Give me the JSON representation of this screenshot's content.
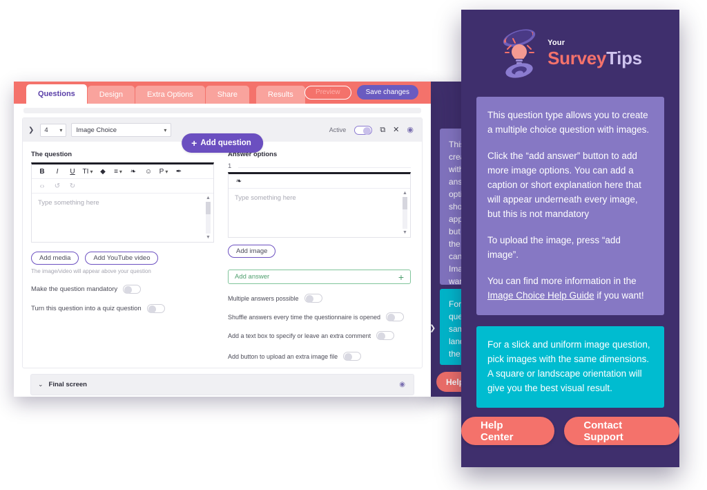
{
  "editor": {
    "tabs": [
      {
        "label": "Questions",
        "active": true
      },
      {
        "label": "Design",
        "active": false
      },
      {
        "label": "Extra Options",
        "active": false
      },
      {
        "label": "Share",
        "active": false
      },
      {
        "label": "Results",
        "active": false
      }
    ],
    "preview_label": "Preview",
    "save_label": "Save changes",
    "add_question_label": "Add question",
    "add_question_plus": "+",
    "question": {
      "number": "4",
      "type": "Image Choice",
      "active_label": "Active",
      "active_on": true,
      "icons": {
        "expand": "❯",
        "duplicate": "⧉",
        "delete": "✕",
        "preview_eye": "◉"
      }
    },
    "left_column": {
      "section_label": "The question",
      "toolbar_row1": [
        "B",
        "I",
        "U",
        "TI",
        "◆",
        "≡",
        "❧",
        "☺",
        "P",
        "✒"
      ],
      "toolbar_row2": [
        "‹›",
        "↺",
        "↻"
      ],
      "placeholder": "Type something here",
      "buttons": [
        {
          "label": "Add media"
        },
        {
          "label": "Add YouTube video"
        }
      ],
      "hint": "The image/video will appear above your question",
      "toggles": [
        {
          "label": "Make the question mandatory",
          "on": false
        },
        {
          "label": "Turn this question into a quiz question",
          "on": false
        }
      ]
    },
    "right_column": {
      "section_label": "Answer options",
      "answer_index": "1",
      "link_icon": "❧",
      "placeholder": "Type something here",
      "add_image_label": "Add image",
      "add_answer_label": "Add answer",
      "add_answer_plus": "+",
      "toggles": [
        {
          "label": "Multiple answers possible",
          "on": false
        },
        {
          "label": "Shuffle answers every time the questionnaire is opened",
          "on": false
        },
        {
          "label": "Add a text box to specify or leave an extra comment",
          "on": false
        },
        {
          "label": "Add button to upload an extra image file",
          "on": false
        }
      ]
    },
    "final_screen": {
      "label": "Final screen",
      "chevron": "⌄",
      "eye": "◉"
    }
  },
  "help_panel": {
    "logo": {
      "your": "Your",
      "survey": "Survey",
      "tips": "Tips",
      "icon_name": "lightbulb-logo-icon"
    },
    "purple_card": {
      "paragraphs": [
        "This question type allows you to create a multiple choice question with images.",
        "Click the “add answer” button to add more image options. You can add a caption or short explanation here that will appear underneath every image, but this is not mandatory",
        "To upload the image, press “add image”."
      ],
      "link_intro": "You can find more information in the",
      "link_text": "Image Choice Help Guide",
      "link_outro": "if you want!"
    },
    "teal_card": {
      "text": "For a slick and uniform image question, pick images with the same dimensions. A square or landscape orientation will give you the best visual result."
    },
    "actions": [
      {
        "label": "Help Center"
      },
      {
        "label": "Contact Support"
      }
    ]
  },
  "background_panel": {
    "arrow": "❯",
    "help_label": "Help",
    "purple_card_text": "This question type allows you to create a multiple choice question with images.\n\nClick the “add answer” button to add more image options. You can add a caption or short explanation here that will appear underneath every image, but this is not mandatory\n\nTo upload the image, press “add image”.\n\nYou can find more information in the Image Choice Help Guide if you want!",
    "teal_card_text": "For a slick and uniform image question, pick images with the same dimensions. A square or landscape orientation will give you the best visual result."
  },
  "colors": {
    "coral": "#f4726b",
    "purple": "#6b4fc0",
    "panel_purple": "#3f2f6d",
    "card_purple": "#8678c4",
    "teal": "#00bcd0",
    "green": "#4e9e6d"
  }
}
